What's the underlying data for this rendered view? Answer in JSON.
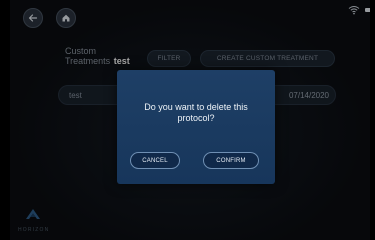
{
  "nav": {
    "back_icon": "arrow-left-icon",
    "home_icon": "home-icon"
  },
  "status_bar": {
    "wifi_icon": "wifi-icon",
    "battery_icon": "battery-icon"
  },
  "list": {
    "heading_line1": "Custom",
    "heading_line2": "Treatments",
    "heading_value": "test",
    "filter_label": "FILTER",
    "create_label": "CREATE CUSTOM TREATMENT",
    "rows": [
      {
        "name": "test",
        "date": "07/14/2020"
      }
    ]
  },
  "dialog": {
    "message": "Do you want to delete this protocol?",
    "cancel_label": "CANCEL",
    "confirm_label": "CONFIRM"
  },
  "brand": {
    "logo_icon": "horizon-logo-icon",
    "name": "HORIZON"
  },
  "colors": {
    "background": "#0b0d11",
    "dialog": "#1e3f66",
    "text_primary": "#ffffff",
    "text_muted": "#8d96a1"
  }
}
